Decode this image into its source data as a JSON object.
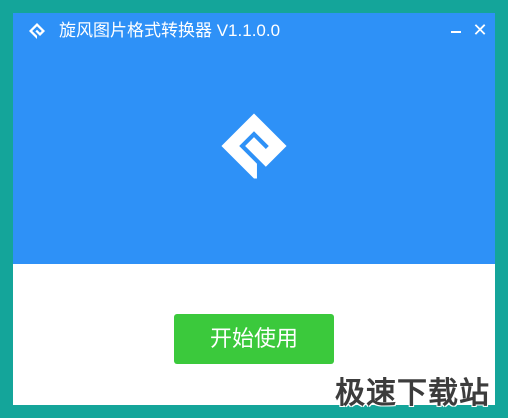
{
  "window": {
    "title": "旋风图片格式转换器 V1.1.0.0",
    "minimize_icon": "minimize-icon",
    "close_glyph": "✕"
  },
  "main": {
    "logo_icon": "app-logo-icon",
    "start_button_label": "开始使用"
  },
  "watermark": {
    "text": "极速下载站"
  },
  "colors": {
    "header_blue": "#2e91f7",
    "button_green": "#3bc93c",
    "background_teal": "#14a59a"
  }
}
